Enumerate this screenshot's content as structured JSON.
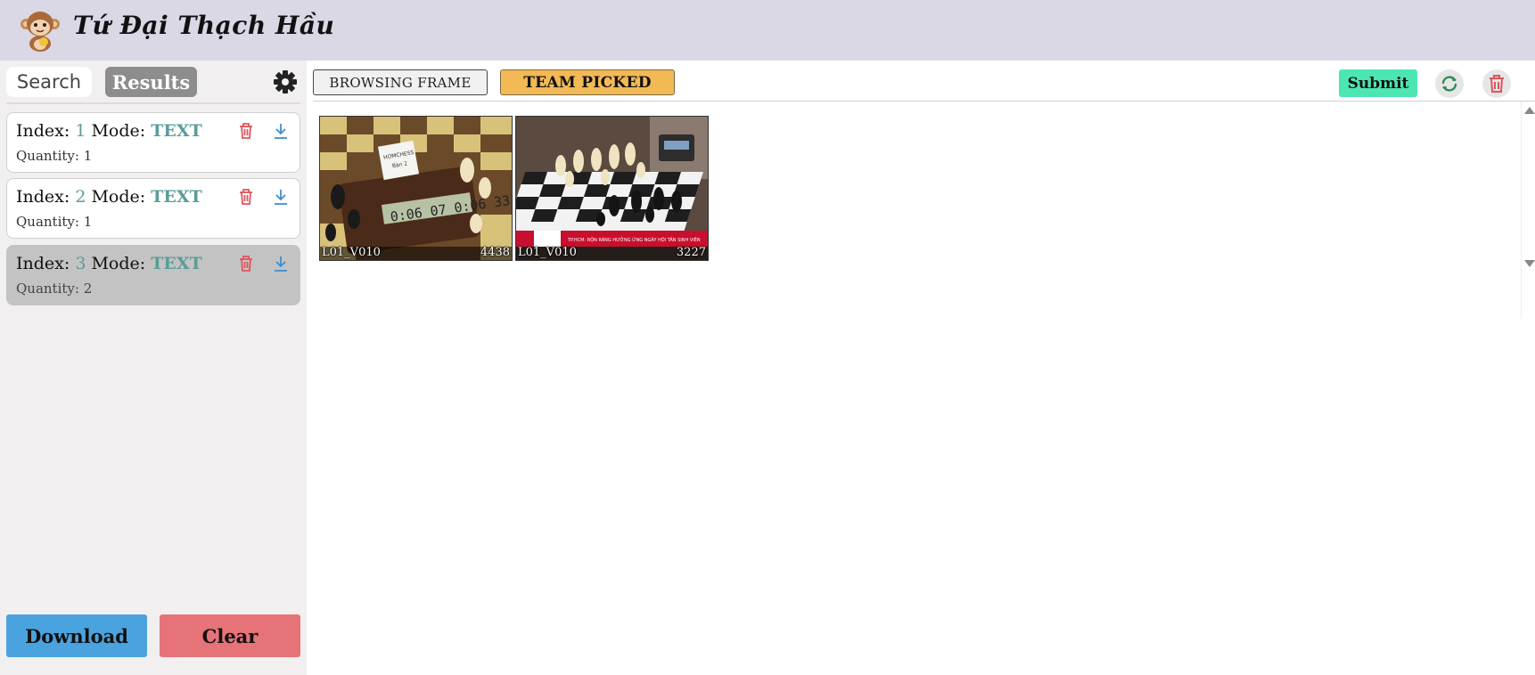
{
  "app": {
    "title": "Tứ Đại Thạch Hầu",
    "logo_icon": "monkey-logo-icon"
  },
  "sidebar": {
    "tabs": {
      "search": "Search",
      "results": "Results"
    },
    "settings_icon": "gear-icon",
    "results": [
      {
        "index_label": "Index:",
        "index": "1",
        "mode_label": "Mode:",
        "mode": "TEXT",
        "quantity_label": "Quantity: 1",
        "selected": false
      },
      {
        "index_label": "Index:",
        "index": "2",
        "mode_label": "Mode:",
        "mode": "TEXT",
        "quantity_label": "Quantity: 1",
        "selected": false
      },
      {
        "index_label": "Index:",
        "index": "3",
        "mode_label": "Mode:",
        "mode": "TEXT",
        "quantity_label": "Quantity: 2",
        "selected": true
      }
    ],
    "download_label": "Download",
    "clear_label": "Clear"
  },
  "main": {
    "tabs": {
      "browsing": "BROWSING FRAME",
      "team_picked": "TEAM PICKED"
    },
    "active_tab": "TEAM PICKED",
    "submit_label": "Submit",
    "refresh_icon": "refresh-icon",
    "trash_icon": "trash-icon",
    "frames": [
      {
        "video": "L01_V010",
        "frame": "4438"
      },
      {
        "video": "L01_V010",
        "frame": "3227"
      }
    ]
  },
  "colors": {
    "header_bg": "#d9d8e4",
    "sidebar_bg": "#f1efef",
    "accent_teal": "#5a9d98",
    "team_tab": "#f2b955",
    "submit": "#4ce6b3",
    "download": "#4aa3df",
    "clear": "#e57378"
  }
}
